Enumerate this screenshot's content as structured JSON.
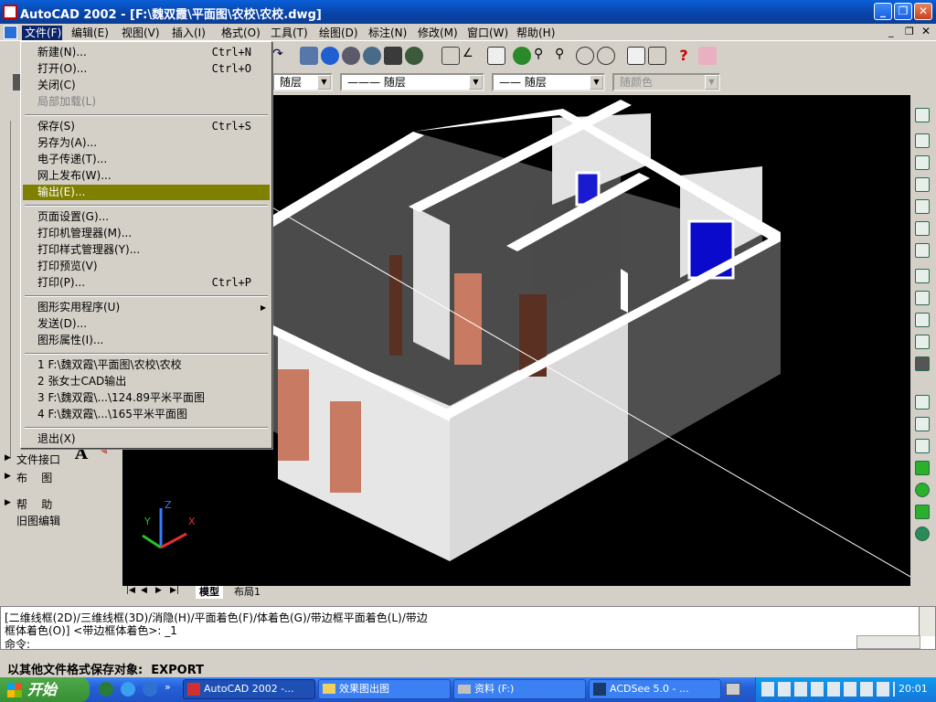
{
  "window": {
    "title": "AutoCAD 2002 - [F:\\魏双霞\\平面图\\农校\\农校.dwg]",
    "controls": [
      "minimize-icon",
      "restore-icon",
      "close-icon"
    ]
  },
  "menubar": {
    "items": [
      "文件(F)",
      "编辑(E)",
      "视图(V)",
      "插入(I)",
      "格式(O)",
      "工具(T)",
      "绘图(D)",
      "标注(N)",
      "修改(M)",
      "窗口(W)",
      "帮助(H)"
    ]
  },
  "properties_toolbar": {
    "layer_value": "随层",
    "linetype_value": "——— 随层",
    "lineweight_value": "—— 随层",
    "color_value": "随颜色"
  },
  "file_menu": {
    "items": [
      {
        "label": "新建(N)...",
        "shortcut": "Ctrl+N"
      },
      {
        "label": "打开(O)...",
        "shortcut": "Ctrl+O"
      },
      {
        "label": "关闭(C)",
        "shortcut": ""
      },
      {
        "label": "局部加载(L)",
        "shortcut": "",
        "disabled": true
      },
      {
        "label": "保存(S)",
        "shortcut": "Ctrl+S"
      },
      {
        "label": "另存为(A)...",
        "shortcut": ""
      },
      {
        "label": "电子传递(T)...",
        "shortcut": ""
      },
      {
        "label": "网上发布(W)...",
        "shortcut": ""
      },
      {
        "label": "输出(E)...",
        "shortcut": "",
        "highlighted": true
      },
      {
        "label": "页面设置(G)...",
        "shortcut": ""
      },
      {
        "label": "打印机管理器(M)...",
        "shortcut": ""
      },
      {
        "label": "打印样式管理器(Y)...",
        "shortcut": ""
      },
      {
        "label": "打印预览(V)",
        "shortcut": ""
      },
      {
        "label": "打印(P)...",
        "shortcut": "Ctrl+P"
      },
      {
        "label": "图形实用程序(U)",
        "shortcut": "",
        "submenu": true
      },
      {
        "label": "发送(D)...",
        "shortcut": ""
      },
      {
        "label": "图形属性(I)...",
        "shortcut": ""
      },
      {
        "label": "1 F:\\魏双霞\\平面图\\农校\\农校",
        "shortcut": ""
      },
      {
        "label": "2 张女士CAD输出",
        "shortcut": ""
      },
      {
        "label": "3 F:\\魏双霞\\...\\124.89平米平面图",
        "shortcut": ""
      },
      {
        "label": "4 F:\\魏双霞\\...\\165平米平面图",
        "shortcut": ""
      },
      {
        "label": "退出(X)",
        "shortcut": ""
      }
    ]
  },
  "left_panel": {
    "items": [
      "文件接口",
      "布    图",
      "帮    助",
      "旧图编辑"
    ]
  },
  "drawing": {
    "tabs": [
      "模型",
      "布局1"
    ],
    "ucs": {
      "x": "X",
      "y": "Y",
      "z": "Z"
    }
  },
  "command": {
    "line1": "[二维线框(2D)/三维线框(3D)/消隐(H)/平面着色(F)/体着色(G)/带边框平面着色(L)/带边",
    "line2": "框体着色(O)] <带边框体着色>: _1",
    "prompt": "命令:"
  },
  "status_text": "以其他文件格式保存对象:  EXPORT",
  "taskbar": {
    "start": "开始",
    "tasks": [
      "AutoCAD 2002 -...",
      "效果图出图",
      "资料 (F:)",
      "ACDSee 5.0 - ..."
    ],
    "clock": "20:01"
  },
  "colors": {
    "menu_highlight": "#808000",
    "titlebar": "#0842a6",
    "drawing_bg": "#000000"
  }
}
